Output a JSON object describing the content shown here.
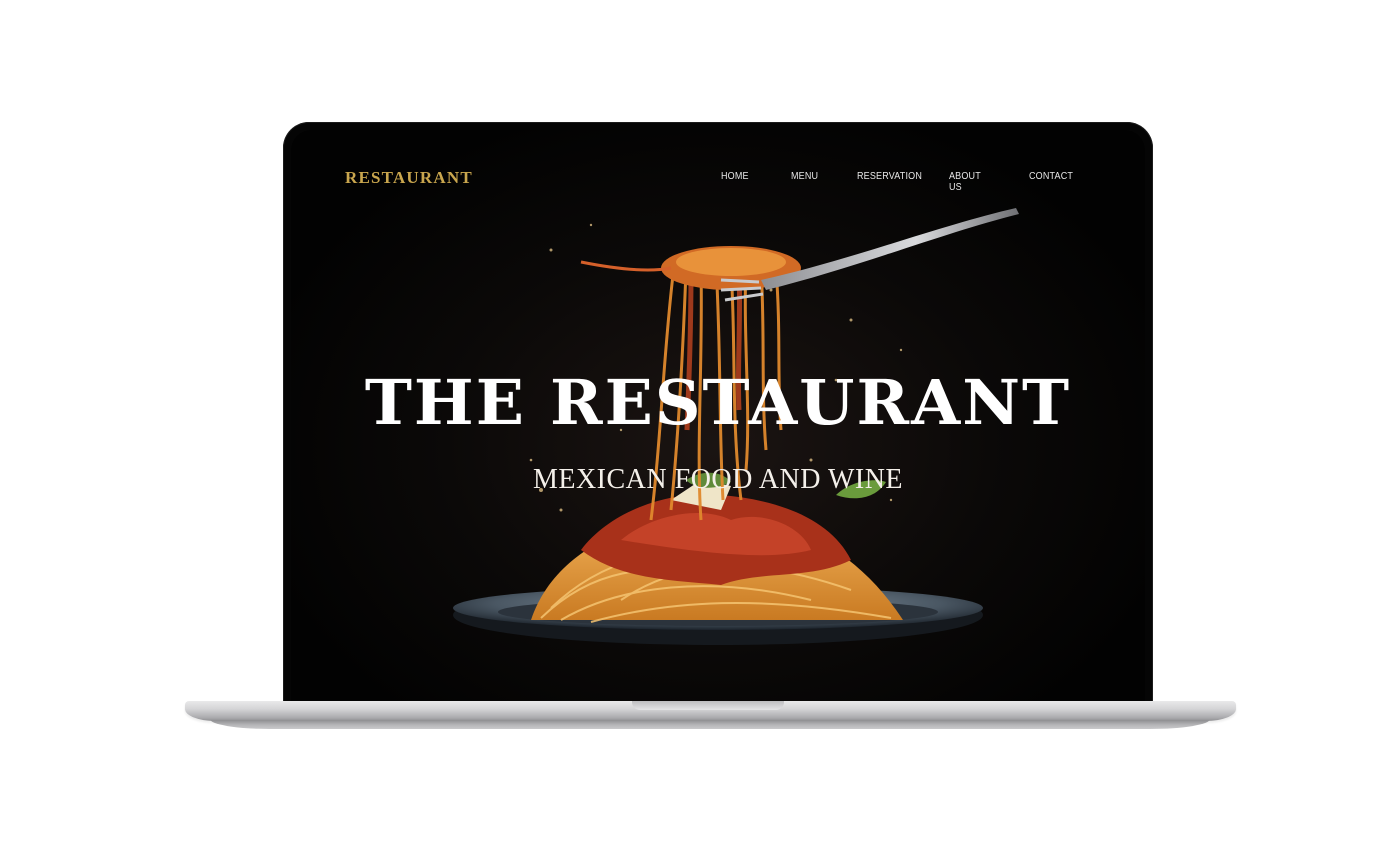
{
  "nav": {
    "brand": "RESTAURANT",
    "items": [
      {
        "label": "HOME"
      },
      {
        "label": "MENU"
      },
      {
        "label": "RESERVATION"
      },
      {
        "label": "ABOUT US"
      },
      {
        "label": "CONTACT"
      }
    ]
  },
  "hero": {
    "title": "THE RESTAURANT",
    "subtitle": "MEXICAN FOOD AND WINE"
  },
  "colors": {
    "brand": "#c9a64e",
    "background": "#050505",
    "text": "#ffffff"
  }
}
